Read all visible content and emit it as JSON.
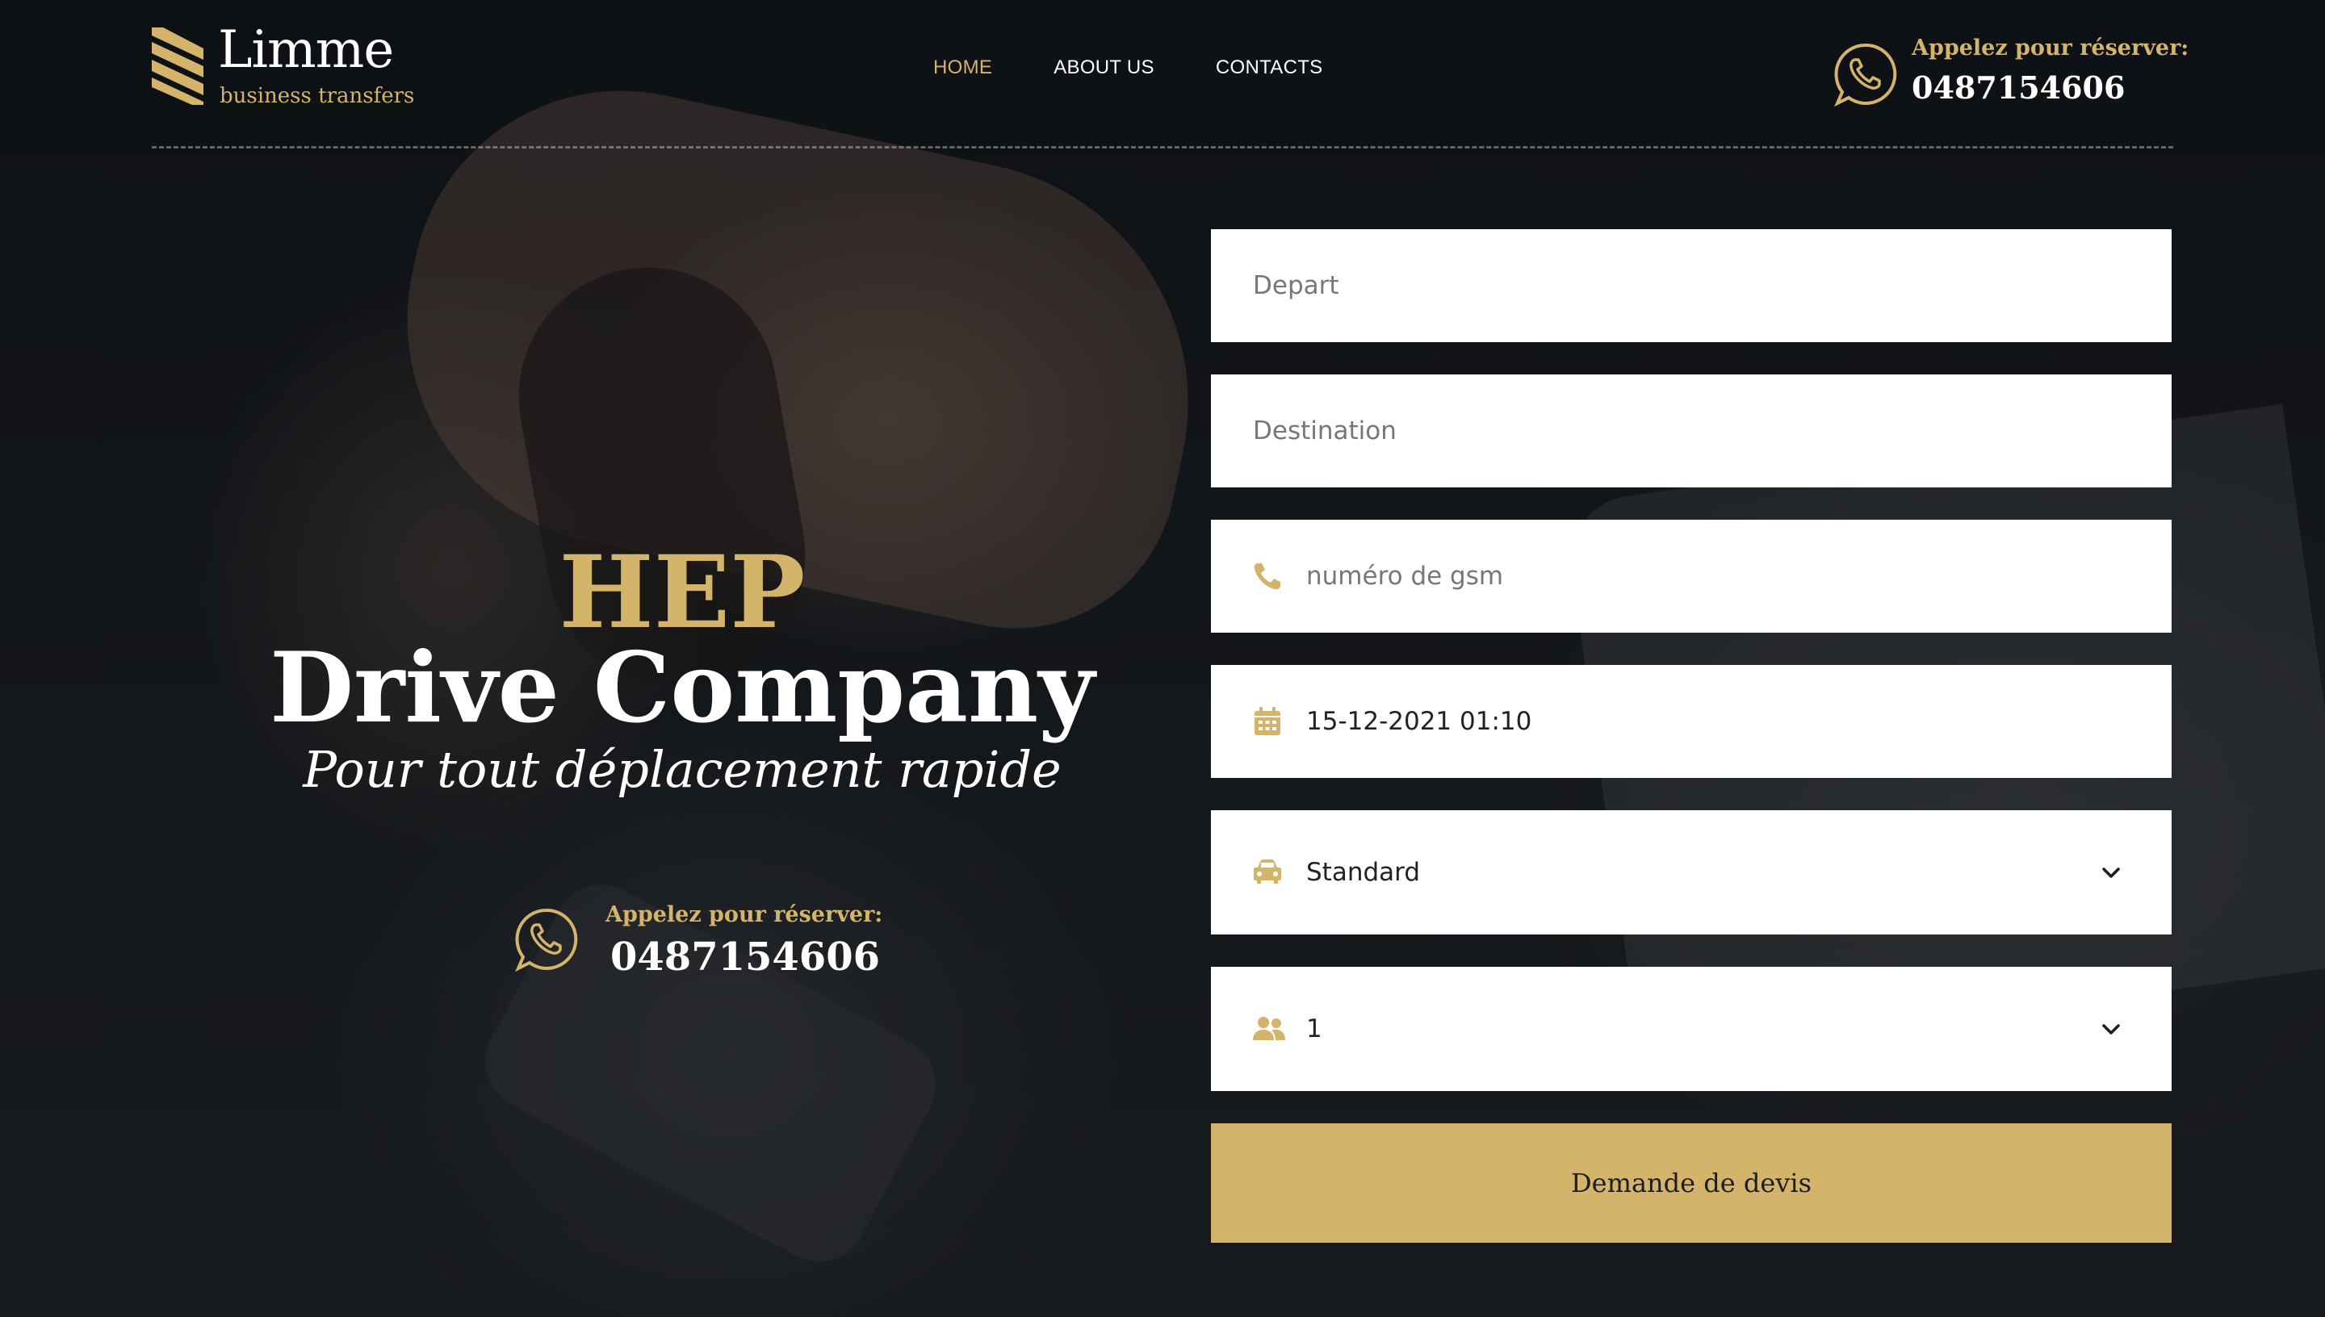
{
  "brand": {
    "name": "Limme",
    "tagline": "business transfers",
    "logo_icon": "stripes-logo-icon"
  },
  "colors": {
    "accent": "#d4b46a",
    "text_light": "#ffffff",
    "field_bg": "#ffffff"
  },
  "nav": {
    "items": [
      {
        "label": "HOME",
        "active": true
      },
      {
        "label": "ABOUT US",
        "active": false
      },
      {
        "label": "CONTACTS",
        "active": false
      }
    ]
  },
  "header_call": {
    "label": "Appelez pour réserver:",
    "number": "0487154606",
    "icon": "whatsapp-phone-icon"
  },
  "hero": {
    "kicker": "HEP",
    "title": "Drive Company",
    "tagline": "Pour tout déplacement rapide",
    "call_label": "Appelez pour réserver:",
    "call_number": "0487154606"
  },
  "form": {
    "depart_placeholder": "Depart",
    "destination_placeholder": "Destination",
    "phone_placeholder": "numéro de gsm",
    "datetime_value": "15-12-2021 01:10",
    "vehicle_value": "Standard",
    "passengers_value": "1",
    "submit_label": "Demande de devis",
    "icons": {
      "phone": "phone-icon",
      "date": "calendar-icon",
      "vehicle": "car-icon",
      "passengers": "users-icon",
      "dropdown": "chevron-down-icon"
    }
  }
}
